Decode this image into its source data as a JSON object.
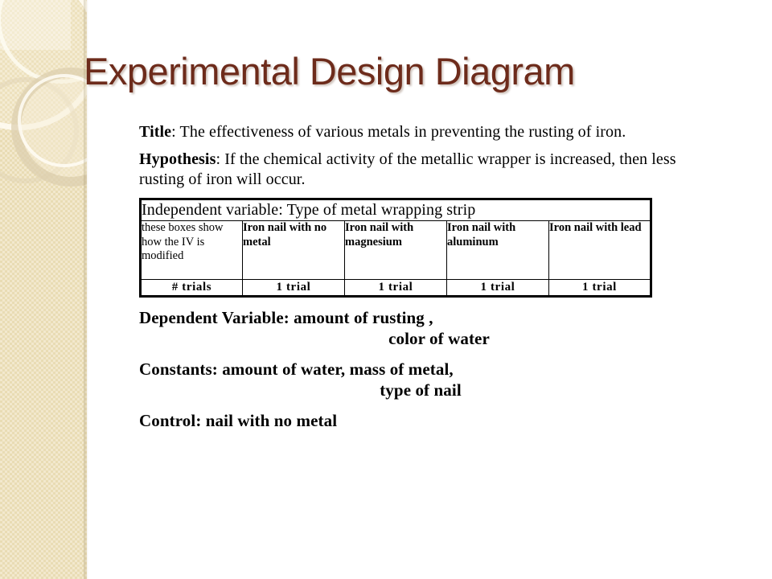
{
  "slide": {
    "title": "Experimental Design Diagram",
    "title_color": "#6d2b1b",
    "background_color": "#ffffff",
    "sidebar_color": "#ece0bd"
  },
  "body": {
    "title_label": "Title",
    "title_text": ": The effectiveness of various metals in preventing the rusting of iron.",
    "hypothesis_label": "Hypothesis",
    "hypothesis_text": ": If the chemical activity of the metallic wrapper is increased, then less rusting of iron will occur."
  },
  "table": {
    "independent_variable_header": "Independent variable: Type of metal wrapping strip",
    "groups": [
      "these boxes show how the IV is modified",
      "Iron nail with no metal",
      "Iron nail with magnesium",
      "Iron nail with aluminum",
      "Iron nail with lead"
    ],
    "trials": [
      "#  trials",
      "1  trial",
      "1  trial",
      "1  trial",
      "1  trial"
    ]
  },
  "footer": {
    "dependent_variable_line1": "Dependent Variable: amount of rusting ,",
    "dependent_variable_line2": "color of water",
    "constants_line1": "Constants: amount of water, mass of metal,",
    "constants_line2": "type of nail",
    "control_line": "Control: nail with no metal"
  }
}
